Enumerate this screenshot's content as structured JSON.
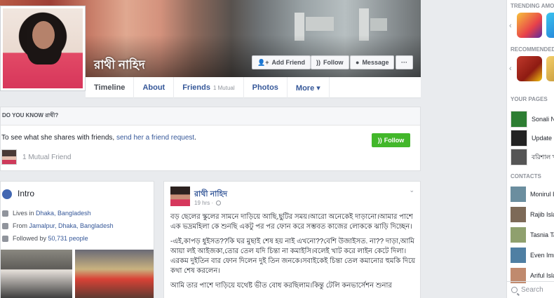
{
  "profile": {
    "name": "রাথী নাহিদ",
    "buttons": {
      "add_friend": "Add Friend",
      "follow": "Follow",
      "message": "Message",
      "more": "···"
    }
  },
  "tabs": [
    {
      "label": "Timeline"
    },
    {
      "label": "About"
    },
    {
      "label": "Friends",
      "sub": "1 Mutual"
    },
    {
      "label": "Photos"
    },
    {
      "label": "More ▾"
    }
  ],
  "do_you_know": {
    "title": "DO YOU KNOW রাথী?",
    "text_prefix": "To see what she shares with friends, ",
    "link": "send her a friend request",
    "text_suffix": ".",
    "follow_label": "Follow",
    "mutual": "1 Mutual Friend"
  },
  "intro": {
    "title": "Intro",
    "lives_prefix": "Lives in ",
    "lives_place": "Dhaka, Bangladesh",
    "from_prefix": "From ",
    "from_place": "Jamalpur, Dhaka, Bangladesh",
    "followed_prefix": "Followed by ",
    "followed_count": "50,731 people"
  },
  "post": {
    "author": "রাথী নাহিদ",
    "time": "19 hrs ·",
    "paragraphs": [
      "বড় ছেলের স্কুলের সামনে দাড়িয়ে আছি,ছুটির সময়।আরো অনেকেই দাড়ানো।আমার পাশে এক ভদ্রমহিলা কে শুনছি একটু পর পর ফোন করে সম্ভবত কাজের লোককে ঝাড়ি দিচ্ছেন।",
      "-এই,কাপড় ধুইসত??কি ঘর মুছাই শেষ হয় নাই এখনো??বেশি উজাইসত. না?? দাড়া,আমি আয়া লই আইজকা,তোর তেল যদি চিন্তা না কমাইসি।বলেই খাট করে লাইন কেটে দিলা।এরকম দুইতিন বার ফোন দিলেন দুই তিন জনকে।সবাইকেই চিন্তা তেল কমানোর হুমকি দিয়ে কথা শেষ করলেন।",
      "আমি তার পাশে দাড়িয়ে যথেষ্ট ভীত বোধ করছিলাম।কিন্তু টেলি কনভার্সেশন শুনার"
    ]
  },
  "rail": {
    "trending_head": "TRENDING AMONG",
    "recommended_head": "RECOMMENDED",
    "pages_head": "YOUR PAGES",
    "pages": [
      "Sonali N",
      "Update E",
      "বরিশাল খ"
    ],
    "contacts_head": "CONTACTS",
    "contacts": [
      "Monirul I",
      "Rajib Isla",
      "Tasnia Ta",
      "Even Imm",
      "Ariful Isla"
    ],
    "search_placeholder": "Search"
  },
  "colors": {
    "fb_blue": "#365899",
    "follow_green": "#42b72a",
    "page_bg": "#e9ebee"
  }
}
